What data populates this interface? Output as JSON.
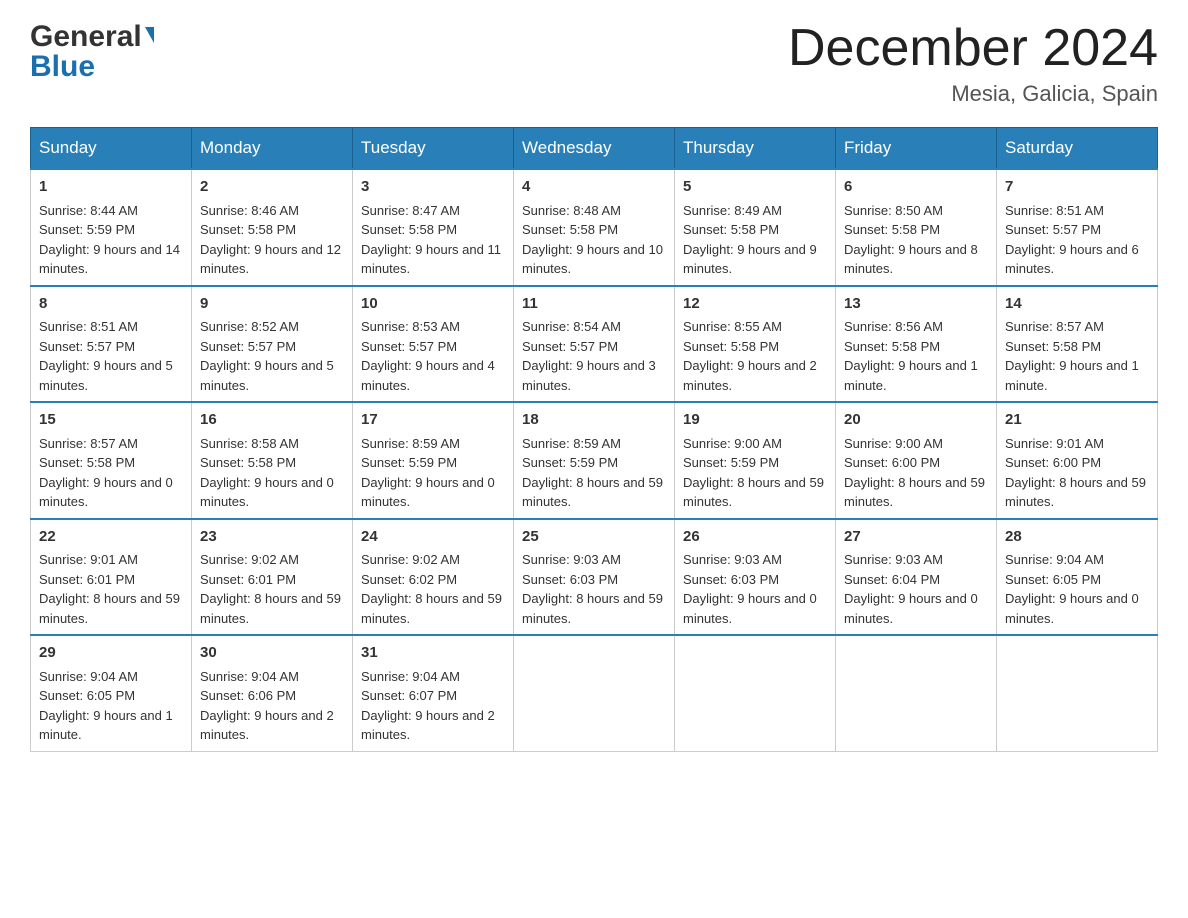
{
  "header": {
    "logo_general": "General",
    "logo_blue": "Blue",
    "title": "December 2024",
    "location": "Mesia, Galicia, Spain"
  },
  "days_of_week": [
    "Sunday",
    "Monday",
    "Tuesday",
    "Wednesday",
    "Thursday",
    "Friday",
    "Saturday"
  ],
  "weeks": [
    [
      {
        "day": "1",
        "sunrise": "8:44 AM",
        "sunset": "5:59 PM",
        "daylight": "9 hours and 14 minutes."
      },
      {
        "day": "2",
        "sunrise": "8:46 AM",
        "sunset": "5:58 PM",
        "daylight": "9 hours and 12 minutes."
      },
      {
        "day": "3",
        "sunrise": "8:47 AM",
        "sunset": "5:58 PM",
        "daylight": "9 hours and 11 minutes."
      },
      {
        "day": "4",
        "sunrise": "8:48 AM",
        "sunset": "5:58 PM",
        "daylight": "9 hours and 10 minutes."
      },
      {
        "day": "5",
        "sunrise": "8:49 AM",
        "sunset": "5:58 PM",
        "daylight": "9 hours and 9 minutes."
      },
      {
        "day": "6",
        "sunrise": "8:50 AM",
        "sunset": "5:58 PM",
        "daylight": "9 hours and 8 minutes."
      },
      {
        "day": "7",
        "sunrise": "8:51 AM",
        "sunset": "5:57 PM",
        "daylight": "9 hours and 6 minutes."
      }
    ],
    [
      {
        "day": "8",
        "sunrise": "8:51 AM",
        "sunset": "5:57 PM",
        "daylight": "9 hours and 5 minutes."
      },
      {
        "day": "9",
        "sunrise": "8:52 AM",
        "sunset": "5:57 PM",
        "daylight": "9 hours and 5 minutes."
      },
      {
        "day": "10",
        "sunrise": "8:53 AM",
        "sunset": "5:57 PM",
        "daylight": "9 hours and 4 minutes."
      },
      {
        "day": "11",
        "sunrise": "8:54 AM",
        "sunset": "5:57 PM",
        "daylight": "9 hours and 3 minutes."
      },
      {
        "day": "12",
        "sunrise": "8:55 AM",
        "sunset": "5:58 PM",
        "daylight": "9 hours and 2 minutes."
      },
      {
        "day": "13",
        "sunrise": "8:56 AM",
        "sunset": "5:58 PM",
        "daylight": "9 hours and 1 minute."
      },
      {
        "day": "14",
        "sunrise": "8:57 AM",
        "sunset": "5:58 PM",
        "daylight": "9 hours and 1 minute."
      }
    ],
    [
      {
        "day": "15",
        "sunrise": "8:57 AM",
        "sunset": "5:58 PM",
        "daylight": "9 hours and 0 minutes."
      },
      {
        "day": "16",
        "sunrise": "8:58 AM",
        "sunset": "5:58 PM",
        "daylight": "9 hours and 0 minutes."
      },
      {
        "day": "17",
        "sunrise": "8:59 AM",
        "sunset": "5:59 PM",
        "daylight": "9 hours and 0 minutes."
      },
      {
        "day": "18",
        "sunrise": "8:59 AM",
        "sunset": "5:59 PM",
        "daylight": "8 hours and 59 minutes."
      },
      {
        "day": "19",
        "sunrise": "9:00 AM",
        "sunset": "5:59 PM",
        "daylight": "8 hours and 59 minutes."
      },
      {
        "day": "20",
        "sunrise": "9:00 AM",
        "sunset": "6:00 PM",
        "daylight": "8 hours and 59 minutes."
      },
      {
        "day": "21",
        "sunrise": "9:01 AM",
        "sunset": "6:00 PM",
        "daylight": "8 hours and 59 minutes."
      }
    ],
    [
      {
        "day": "22",
        "sunrise": "9:01 AM",
        "sunset": "6:01 PM",
        "daylight": "8 hours and 59 minutes."
      },
      {
        "day": "23",
        "sunrise": "9:02 AM",
        "sunset": "6:01 PM",
        "daylight": "8 hours and 59 minutes."
      },
      {
        "day": "24",
        "sunrise": "9:02 AM",
        "sunset": "6:02 PM",
        "daylight": "8 hours and 59 minutes."
      },
      {
        "day": "25",
        "sunrise": "9:03 AM",
        "sunset": "6:03 PM",
        "daylight": "8 hours and 59 minutes."
      },
      {
        "day": "26",
        "sunrise": "9:03 AM",
        "sunset": "6:03 PM",
        "daylight": "9 hours and 0 minutes."
      },
      {
        "day": "27",
        "sunrise": "9:03 AM",
        "sunset": "6:04 PM",
        "daylight": "9 hours and 0 minutes."
      },
      {
        "day": "28",
        "sunrise": "9:04 AM",
        "sunset": "6:05 PM",
        "daylight": "9 hours and 0 minutes."
      }
    ],
    [
      {
        "day": "29",
        "sunrise": "9:04 AM",
        "sunset": "6:05 PM",
        "daylight": "9 hours and 1 minute."
      },
      {
        "day": "30",
        "sunrise": "9:04 AM",
        "sunset": "6:06 PM",
        "daylight": "9 hours and 2 minutes."
      },
      {
        "day": "31",
        "sunrise": "9:04 AM",
        "sunset": "6:07 PM",
        "daylight": "9 hours and 2 minutes."
      },
      null,
      null,
      null,
      null
    ]
  ],
  "labels": {
    "sunrise": "Sunrise:",
    "sunset": "Sunset:",
    "daylight": "Daylight:"
  }
}
